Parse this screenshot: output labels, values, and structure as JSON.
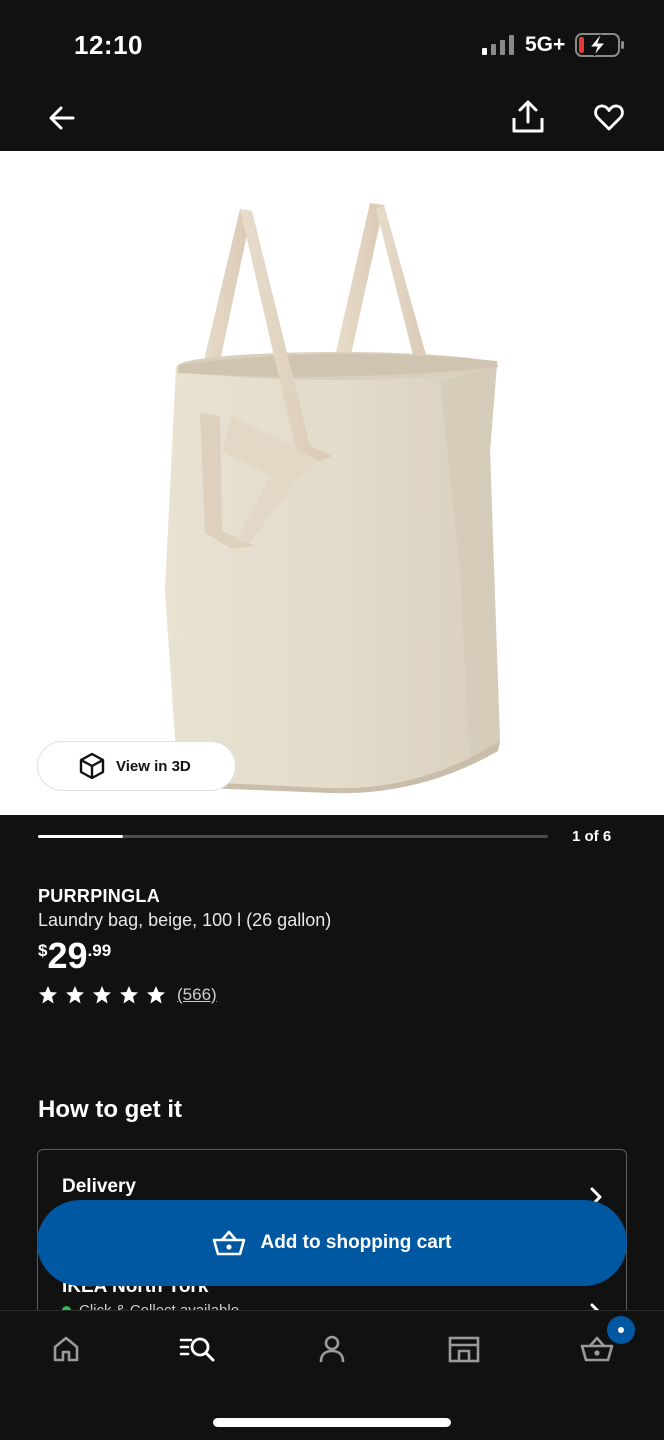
{
  "status_bar": {
    "time": "12:10",
    "network": "5G+",
    "battery_color": "#e53935"
  },
  "top_bar": {
    "back_icon": "arrow-left-icon",
    "share_icon": "share-icon",
    "favorite_icon": "heart-icon"
  },
  "gallery": {
    "image_description_icon": "laundry-bag-product-image",
    "view_3d_label": "View in 3D",
    "counter": "1 of 6",
    "progress": 0.167
  },
  "product": {
    "brand": "PURRPINGLA",
    "description": "Laundry bag, beige, 100 l (26 gallon)",
    "price_currency": "$",
    "price_integer": "29",
    "price_decimal": ".99",
    "rating_stars": 5,
    "reviews": "(566)"
  },
  "fulfillment": {
    "title": "How to get it",
    "delivery_label": "Delivery",
    "store_label": "IKEA North York",
    "store_sub": "Click & Collect available"
  },
  "cart_button": {
    "label": "Add to shopping cart"
  },
  "bottom_nav": {
    "items": [
      "home-icon",
      "search-icon",
      "profile-icon",
      "store-icon",
      "cart-icon"
    ]
  },
  "colors": {
    "background": "#111111",
    "accent_blue": "#0058a3"
  }
}
